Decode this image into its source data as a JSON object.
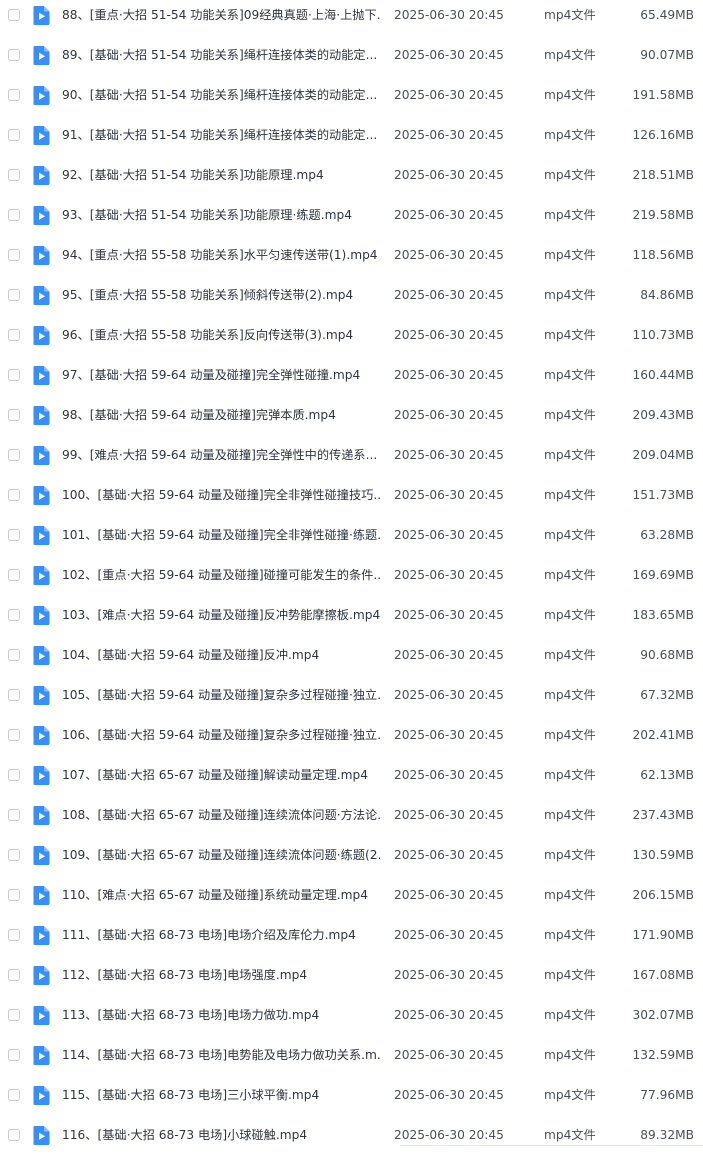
{
  "files": [
    {
      "name": "88、[重点·大招 51-54 功能关系]09经典真题·上海·上抛下...",
      "date": "2025-06-30 20:45",
      "type": "mp4文件",
      "size": "65.49MB"
    },
    {
      "name": "89、[基础·大招 51-54 功能关系]绳杆连接体类的动能定...",
      "date": "2025-06-30 20:45",
      "type": "mp4文件",
      "size": "90.07MB"
    },
    {
      "name": "90、[基础·大招 51-54 功能关系]绳杆连接体类的动能定...",
      "date": "2025-06-30 20:45",
      "type": "mp4文件",
      "size": "191.58MB"
    },
    {
      "name": "91、[基础·大招 51-54 功能关系]绳杆连接体类的动能定...",
      "date": "2025-06-30 20:45",
      "type": "mp4文件",
      "size": "126.16MB"
    },
    {
      "name": "92、[基础·大招 51-54 功能关系]功能原理.mp4",
      "date": "2025-06-30 20:45",
      "type": "mp4文件",
      "size": "218.51MB"
    },
    {
      "name": "93、[基础·大招 51-54 功能关系]功能原理·练题.mp4",
      "date": "2025-06-30 20:45",
      "type": "mp4文件",
      "size": "219.58MB"
    },
    {
      "name": "94、[重点·大招 55-58 功能关系]水平匀速传送带(1).mp4",
      "date": "2025-06-30 20:45",
      "type": "mp4文件",
      "size": "118.56MB"
    },
    {
      "name": "95、[重点·大招 55-58 功能关系]倾斜传送带(2).mp4",
      "date": "2025-06-30 20:45",
      "type": "mp4文件",
      "size": "84.86MB"
    },
    {
      "name": "96、[重点·大招 55-58 功能关系]反向传送带(3).mp4",
      "date": "2025-06-30 20:45",
      "type": "mp4文件",
      "size": "110.73MB"
    },
    {
      "name": "97、[基础·大招 59-64 动量及碰撞]完全弹性碰撞.mp4",
      "date": "2025-06-30 20:45",
      "type": "mp4文件",
      "size": "160.44MB"
    },
    {
      "name": "98、[基础·大招 59-64 动量及碰撞]完弹本质.mp4",
      "date": "2025-06-30 20:45",
      "type": "mp4文件",
      "size": "209.43MB"
    },
    {
      "name": "99、[难点·大招 59-64 动量及碰撞]完全弹性中的传递系...",
      "date": "2025-06-30 20:45",
      "type": "mp4文件",
      "size": "209.04MB"
    },
    {
      "name": "100、[基础·大招 59-64 动量及碰撞]完全非弹性碰撞技巧....",
      "date": "2025-06-30 20:45",
      "type": "mp4文件",
      "size": "151.73MB"
    },
    {
      "name": "101、[基础·大招 59-64 动量及碰撞]完全非弹性碰撞·练题...",
      "date": "2025-06-30 20:45",
      "type": "mp4文件",
      "size": "63.28MB"
    },
    {
      "name": "102、[重点·大招 59-64 动量及碰撞]碰撞可能发生的条件....",
      "date": "2025-06-30 20:45",
      "type": "mp4文件",
      "size": "169.69MB"
    },
    {
      "name": "103、[难点·大招 59-64 动量及碰撞]反冲势能摩擦板.mp4",
      "date": "2025-06-30 20:45",
      "type": "mp4文件",
      "size": "183.65MB"
    },
    {
      "name": "104、[基础·大招 59-64 动量及碰撞]反冲.mp4",
      "date": "2025-06-30 20:45",
      "type": "mp4文件",
      "size": "90.68MB"
    },
    {
      "name": "105、[基础·大招 59-64 动量及碰撞]复杂多过程碰撞·独立...",
      "date": "2025-06-30 20:45",
      "type": "mp4文件",
      "size": "67.32MB"
    },
    {
      "name": "106、[基础·大招 59-64 动量及碰撞]复杂多过程碰撞·独立...",
      "date": "2025-06-30 20:45",
      "type": "mp4文件",
      "size": "202.41MB"
    },
    {
      "name": "107、[基础·大招 65-67 动量及碰撞]解读动量定理.mp4",
      "date": "2025-06-30 20:45",
      "type": "mp4文件",
      "size": "62.13MB"
    },
    {
      "name": "108、[基础·大招 65-67 动量及碰撞]连续流体问题·方法论...",
      "date": "2025-06-30 20:45",
      "type": "mp4文件",
      "size": "237.43MB"
    },
    {
      "name": "109、[基础·大招 65-67 动量及碰撞]连续流体问题·练题(2...",
      "date": "2025-06-30 20:45",
      "type": "mp4文件",
      "size": "130.59MB"
    },
    {
      "name": "110、[难点·大招 65-67 动量及碰撞]系统动量定理.mp4",
      "date": "2025-06-30 20:45",
      "type": "mp4文件",
      "size": "206.15MB"
    },
    {
      "name": "111、[基础·大招 68-73 电场]电场介绍及库伦力.mp4",
      "date": "2025-06-30 20:45",
      "type": "mp4文件",
      "size": "171.90MB"
    },
    {
      "name": "112、[基础·大招 68-73 电场]电场强度.mp4",
      "date": "2025-06-30 20:45",
      "type": "mp4文件",
      "size": "167.08MB"
    },
    {
      "name": "113、[基础·大招 68-73 电场]电场力做功.mp4",
      "date": "2025-06-30 20:45",
      "type": "mp4文件",
      "size": "302.07MB"
    },
    {
      "name": "114、[基础·大招 68-73 电场]电势能及电场力做功关系.m...",
      "date": "2025-06-30 20:45",
      "type": "mp4文件",
      "size": "132.59MB"
    },
    {
      "name": "115、[基础·大招 68-73 电场]三小球平衡.mp4",
      "date": "2025-06-30 20:45",
      "type": "mp4文件",
      "size": "77.96MB"
    },
    {
      "name": "116、[基础·大招 68-73 电场]小球碰触.mp4",
      "date": "2025-06-30 20:45",
      "type": "mp4文件",
      "size": "89.32MB"
    }
  ],
  "icon": "video-file-icon",
  "colors": {
    "icon_blue": "#3a8ff5",
    "text": "#2f3540",
    "muted_text": "#4a505a",
    "checkbox_border": "#c9ccd2"
  }
}
